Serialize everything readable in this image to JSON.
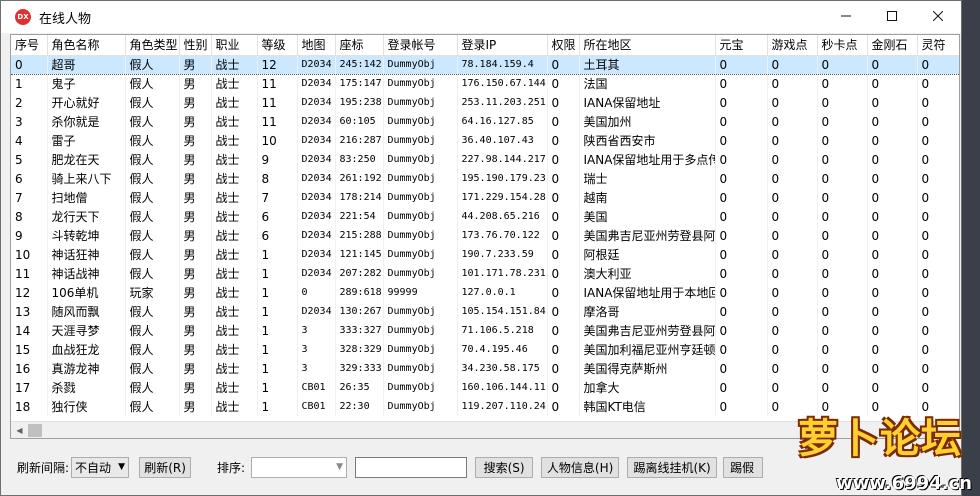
{
  "window": {
    "app_icon_text": "DX",
    "title": "在线人物"
  },
  "columns": [
    "序号",
    "角色名称",
    "角色类型",
    "性别",
    "职业",
    "等级",
    "地图",
    "座标",
    "登录帐号",
    "登录IP",
    "权限",
    "所在地区",
    "元宝",
    "游戏点",
    "秒卡点",
    "金刚石",
    "灵符"
  ],
  "rows": [
    [
      "0",
      "超哥",
      "假人",
      "男",
      "战士",
      "12",
      "D2034",
      "245:142",
      "DummyObj",
      "78.184.159.4",
      "0",
      "土耳其",
      "0",
      "0",
      "0",
      "0",
      "0"
    ],
    [
      "1",
      "鬼子",
      "假人",
      "男",
      "战士",
      "11",
      "D2034",
      "175:147",
      "DummyObj",
      "176.150.67.144",
      "0",
      "法国",
      "0",
      "0",
      "0",
      "0",
      "0"
    ],
    [
      "2",
      "开心就好",
      "假人",
      "男",
      "战士",
      "11",
      "D2034",
      "195:238",
      "DummyObj",
      "253.11.203.251",
      "0",
      "IANA保留地址",
      "0",
      "0",
      "0",
      "0",
      "0"
    ],
    [
      "3",
      "杀你就是",
      "假人",
      "男",
      "战士",
      "11",
      "D2034",
      "60:105",
      "DummyObj",
      "64.16.127.85",
      "0",
      "美国加州",
      "0",
      "0",
      "0",
      "0",
      "0"
    ],
    [
      "4",
      "雷子",
      "假人",
      "男",
      "战士",
      "10",
      "D2034",
      "216:287",
      "DummyObj",
      "36.40.107.43",
      "0",
      "陕西省西安市",
      "0",
      "0",
      "0",
      "0",
      "0"
    ],
    [
      "5",
      "肥龙在天",
      "假人",
      "男",
      "战士",
      "9",
      "D2034",
      "83:250",
      "DummyObj",
      "227.98.144.217",
      "0",
      "IANA保留地址用于多点传",
      "0",
      "0",
      "0",
      "0",
      "0"
    ],
    [
      "6",
      "骑上来八下",
      "假人",
      "男",
      "战士",
      "8",
      "D2034",
      "261:192",
      "DummyObj",
      "195.190.179.23",
      "0",
      "瑞士",
      "0",
      "0",
      "0",
      "0",
      "0"
    ],
    [
      "7",
      "扫地僧",
      "假人",
      "男",
      "战士",
      "7",
      "D2034",
      "178:214",
      "DummyObj",
      "171.229.154.28",
      "0",
      "越南",
      "0",
      "0",
      "0",
      "0",
      "0"
    ],
    [
      "8",
      "龙行天下",
      "假人",
      "男",
      "战士",
      "6",
      "D2034",
      "221:54",
      "DummyObj",
      "44.208.65.216",
      "0",
      "美国",
      "0",
      "0",
      "0",
      "0",
      "0"
    ],
    [
      "9",
      "斗转乾坤",
      "假人",
      "男",
      "战士",
      "6",
      "D2034",
      "215:288",
      "DummyObj",
      "173.76.70.122",
      "0",
      "美国弗吉尼亚州劳登县阿",
      "0",
      "0",
      "0",
      "0",
      "0"
    ],
    [
      "10",
      "神话狂神",
      "假人",
      "男",
      "战士",
      "1",
      "D2034",
      "121:145",
      "DummyObj",
      "190.7.233.59",
      "0",
      "阿根廷",
      "0",
      "0",
      "0",
      "0",
      "0"
    ],
    [
      "11",
      "神话战神",
      "假人",
      "男",
      "战士",
      "1",
      "D2034",
      "207:282",
      "DummyObj",
      "101.171.78.231",
      "0",
      "澳大利亚",
      "0",
      "0",
      "0",
      "0",
      "0"
    ],
    [
      "12",
      "106单机",
      "玩家",
      "男",
      "战士",
      "1",
      "0",
      "289:618",
      "99999",
      "127.0.0.1",
      "0",
      "IANA保留地址用于本地回",
      "0",
      "0",
      "0",
      "0",
      "0"
    ],
    [
      "13",
      "随风而飘",
      "假人",
      "男",
      "战士",
      "1",
      "D2034",
      "130:267",
      "DummyObj",
      "105.154.151.84",
      "0",
      "摩洛哥",
      "0",
      "0",
      "0",
      "0",
      "0"
    ],
    [
      "14",
      "天涯寻梦",
      "假人",
      "男",
      "战士",
      "1",
      "3",
      "333:327",
      "DummyObj",
      "71.106.5.218",
      "0",
      "美国弗吉尼亚州劳登县阿",
      "0",
      "0",
      "0",
      "0",
      "0"
    ],
    [
      "15",
      "血战狂龙",
      "假人",
      "男",
      "战士",
      "1",
      "3",
      "328:329",
      "DummyObj",
      "70.4.195.46",
      "0",
      "美国加利福尼亚州亨廷顿",
      "0",
      "0",
      "0",
      "0",
      "0"
    ],
    [
      "16",
      "真游龙神",
      "假人",
      "男",
      "战士",
      "1",
      "3",
      "329:333",
      "DummyObj",
      "34.230.58.175",
      "0",
      "美国得克萨斯州",
      "0",
      "0",
      "0",
      "0",
      "0"
    ],
    [
      "17",
      "杀戮",
      "假人",
      "男",
      "战士",
      "1",
      "CB01",
      "26:35",
      "DummyObj",
      "160.106.144.11",
      "0",
      "加拿大",
      "0",
      "0",
      "0",
      "0",
      "0"
    ],
    [
      "18",
      "独行侠",
      "假人",
      "男",
      "战士",
      "1",
      "CB01",
      "22:30",
      "DummyObj",
      "119.207.110.24",
      "0",
      "韩国KT电信",
      "0",
      "0",
      "0",
      "0",
      "0"
    ]
  ],
  "selected_row": 0,
  "toolbar": {
    "refresh_interval_label": "刷新间隔:",
    "refresh_interval_value": "不自动",
    "refresh_button": "刷新(R)",
    "sort_label": "排序:",
    "sort_value": "",
    "search_value": "",
    "search_button": "搜索(S)",
    "info_button": "人物信息(H)",
    "kick_offline_button": "踢离线挂机(K)",
    "kick_button": "踢假"
  },
  "watermark": {
    "brand": "萝卜论坛",
    "site": "www.6994.cn"
  },
  "colors": {
    "selected_row": "#cce8ff",
    "window_bg": "#f0f0f0",
    "app_icon": "#e03030"
  }
}
